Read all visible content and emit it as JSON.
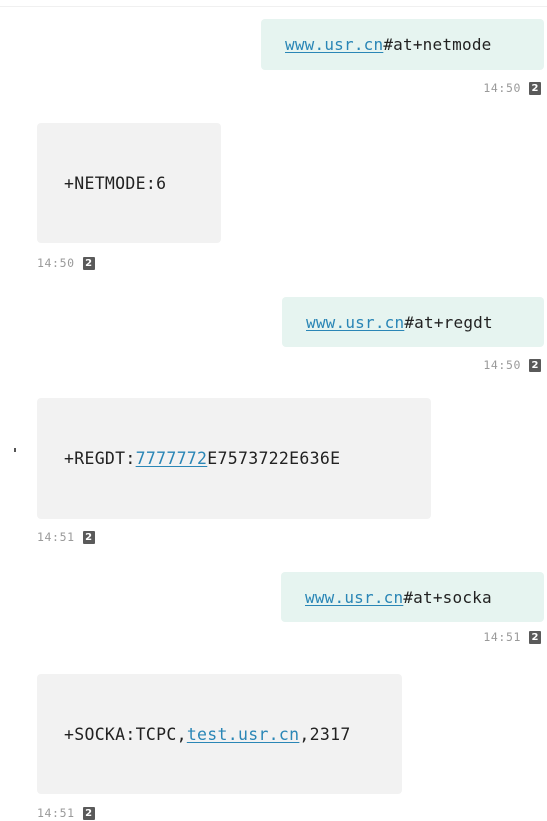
{
  "messages": [
    {
      "direction": "sent",
      "link": "www.usr.cn",
      "text": "#at+netmode",
      "time": "14:50",
      "badge": "2"
    },
    {
      "direction": "received",
      "text": "+NETMODE:6",
      "time": "14:50",
      "badge": "2"
    },
    {
      "direction": "sent",
      "link": "www.usr.cn",
      "text": "#at+regdt",
      "time": "14:50",
      "badge": "2"
    },
    {
      "direction": "received",
      "prefix": "+REGDT:",
      "link": "7777772",
      "suffix": "E7573722E636E",
      "time": "14:51",
      "badge": "2"
    },
    {
      "direction": "sent",
      "link": "www.usr.cn",
      "text": "#at+socka",
      "time": "14:51",
      "badge": "2"
    },
    {
      "direction": "received",
      "prefix": "+SOCKA:TCPC,",
      "link": "test.usr.cn",
      "suffix": ",2317",
      "time": "14:51",
      "badge": "2"
    }
  ]
}
